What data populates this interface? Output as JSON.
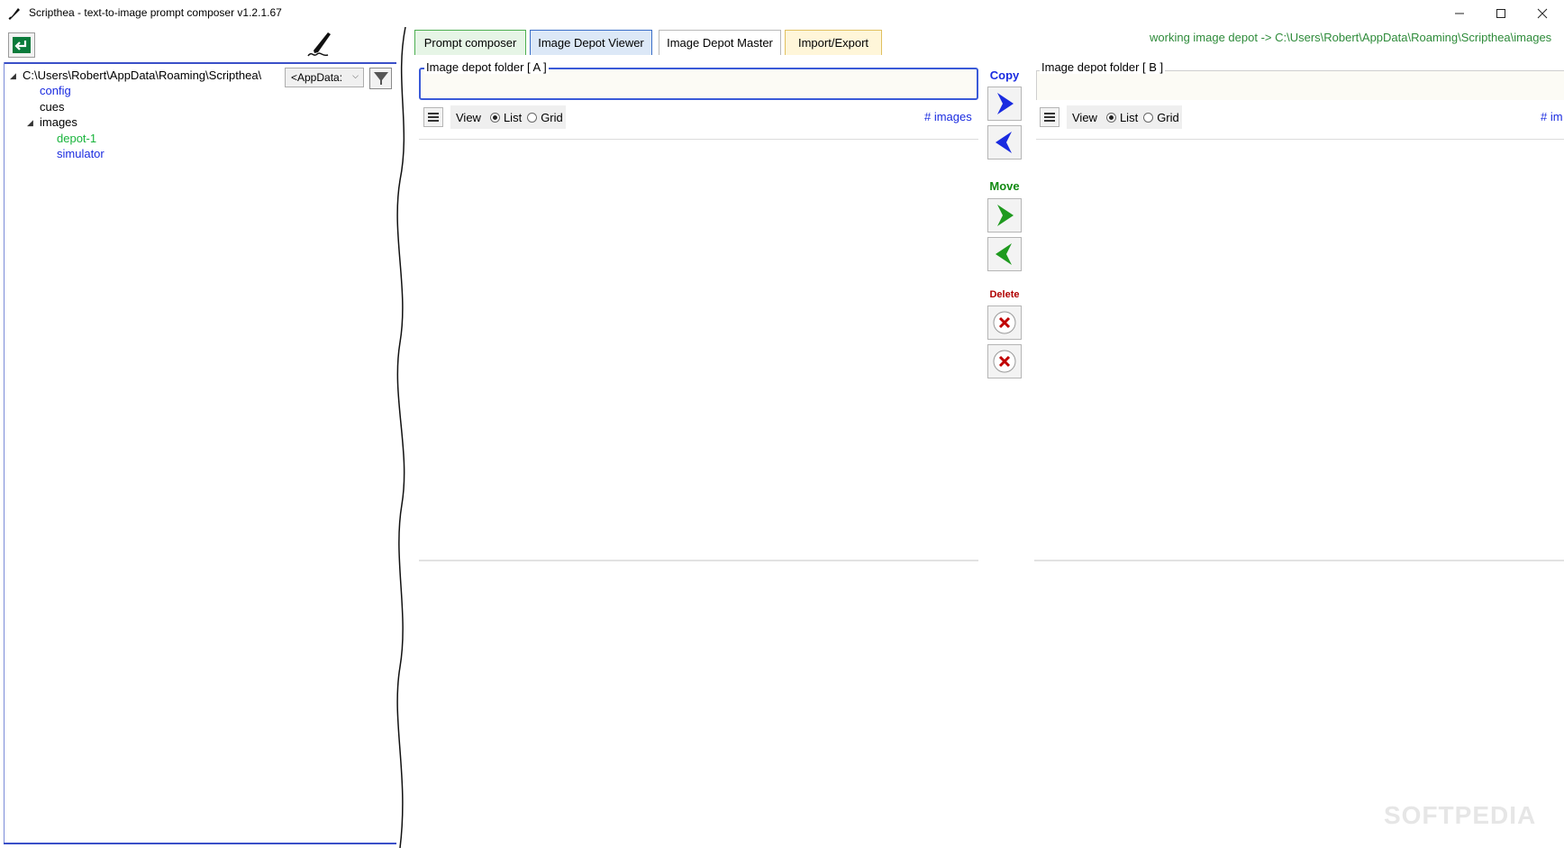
{
  "window": {
    "title": "Scripthea - text-to-image prompt composer v1.2.1.67"
  },
  "left_panel": {
    "tree": {
      "root": "C:\\Users\\Robert\\AppData\\Roaming\\Scripthea\\",
      "items": [
        "config",
        "cues",
        "images",
        "depot-1",
        "simulator"
      ]
    },
    "location_select": "<AppData:",
    "colors": {
      "config": "#1a2be0",
      "depot_selected": "#19b43c",
      "simulator": "#1a2be0"
    }
  },
  "tabs": [
    "Prompt composer",
    "Image Depot Viewer",
    "Image Depot Master",
    "Import/Export"
  ],
  "active_tab": "Image Depot Master",
  "working_depot": "working image depot -> C:\\Users\\Robert\\AppData\\Roaming\\Scripthea\\images",
  "panel_a": {
    "folder_label": "Image depot folder [ A ]",
    "view_label": "View",
    "list_label": "List",
    "grid_label": "Grid",
    "selected_view": "List",
    "count_link": "# images"
  },
  "panel_b": {
    "folder_label": "Image depot folder [ B ]",
    "view_label": "View",
    "list_label": "List",
    "grid_label": "Grid",
    "selected_view": "List",
    "count_link": "# im"
  },
  "actions": {
    "copy_label": "Copy",
    "move_label": "Move",
    "delete_label": "Delete",
    "copy_color": "#1a2be0",
    "move_color": "#128a12",
    "delete_color": "#b00000"
  },
  "watermark": "SOFTPEDIA"
}
